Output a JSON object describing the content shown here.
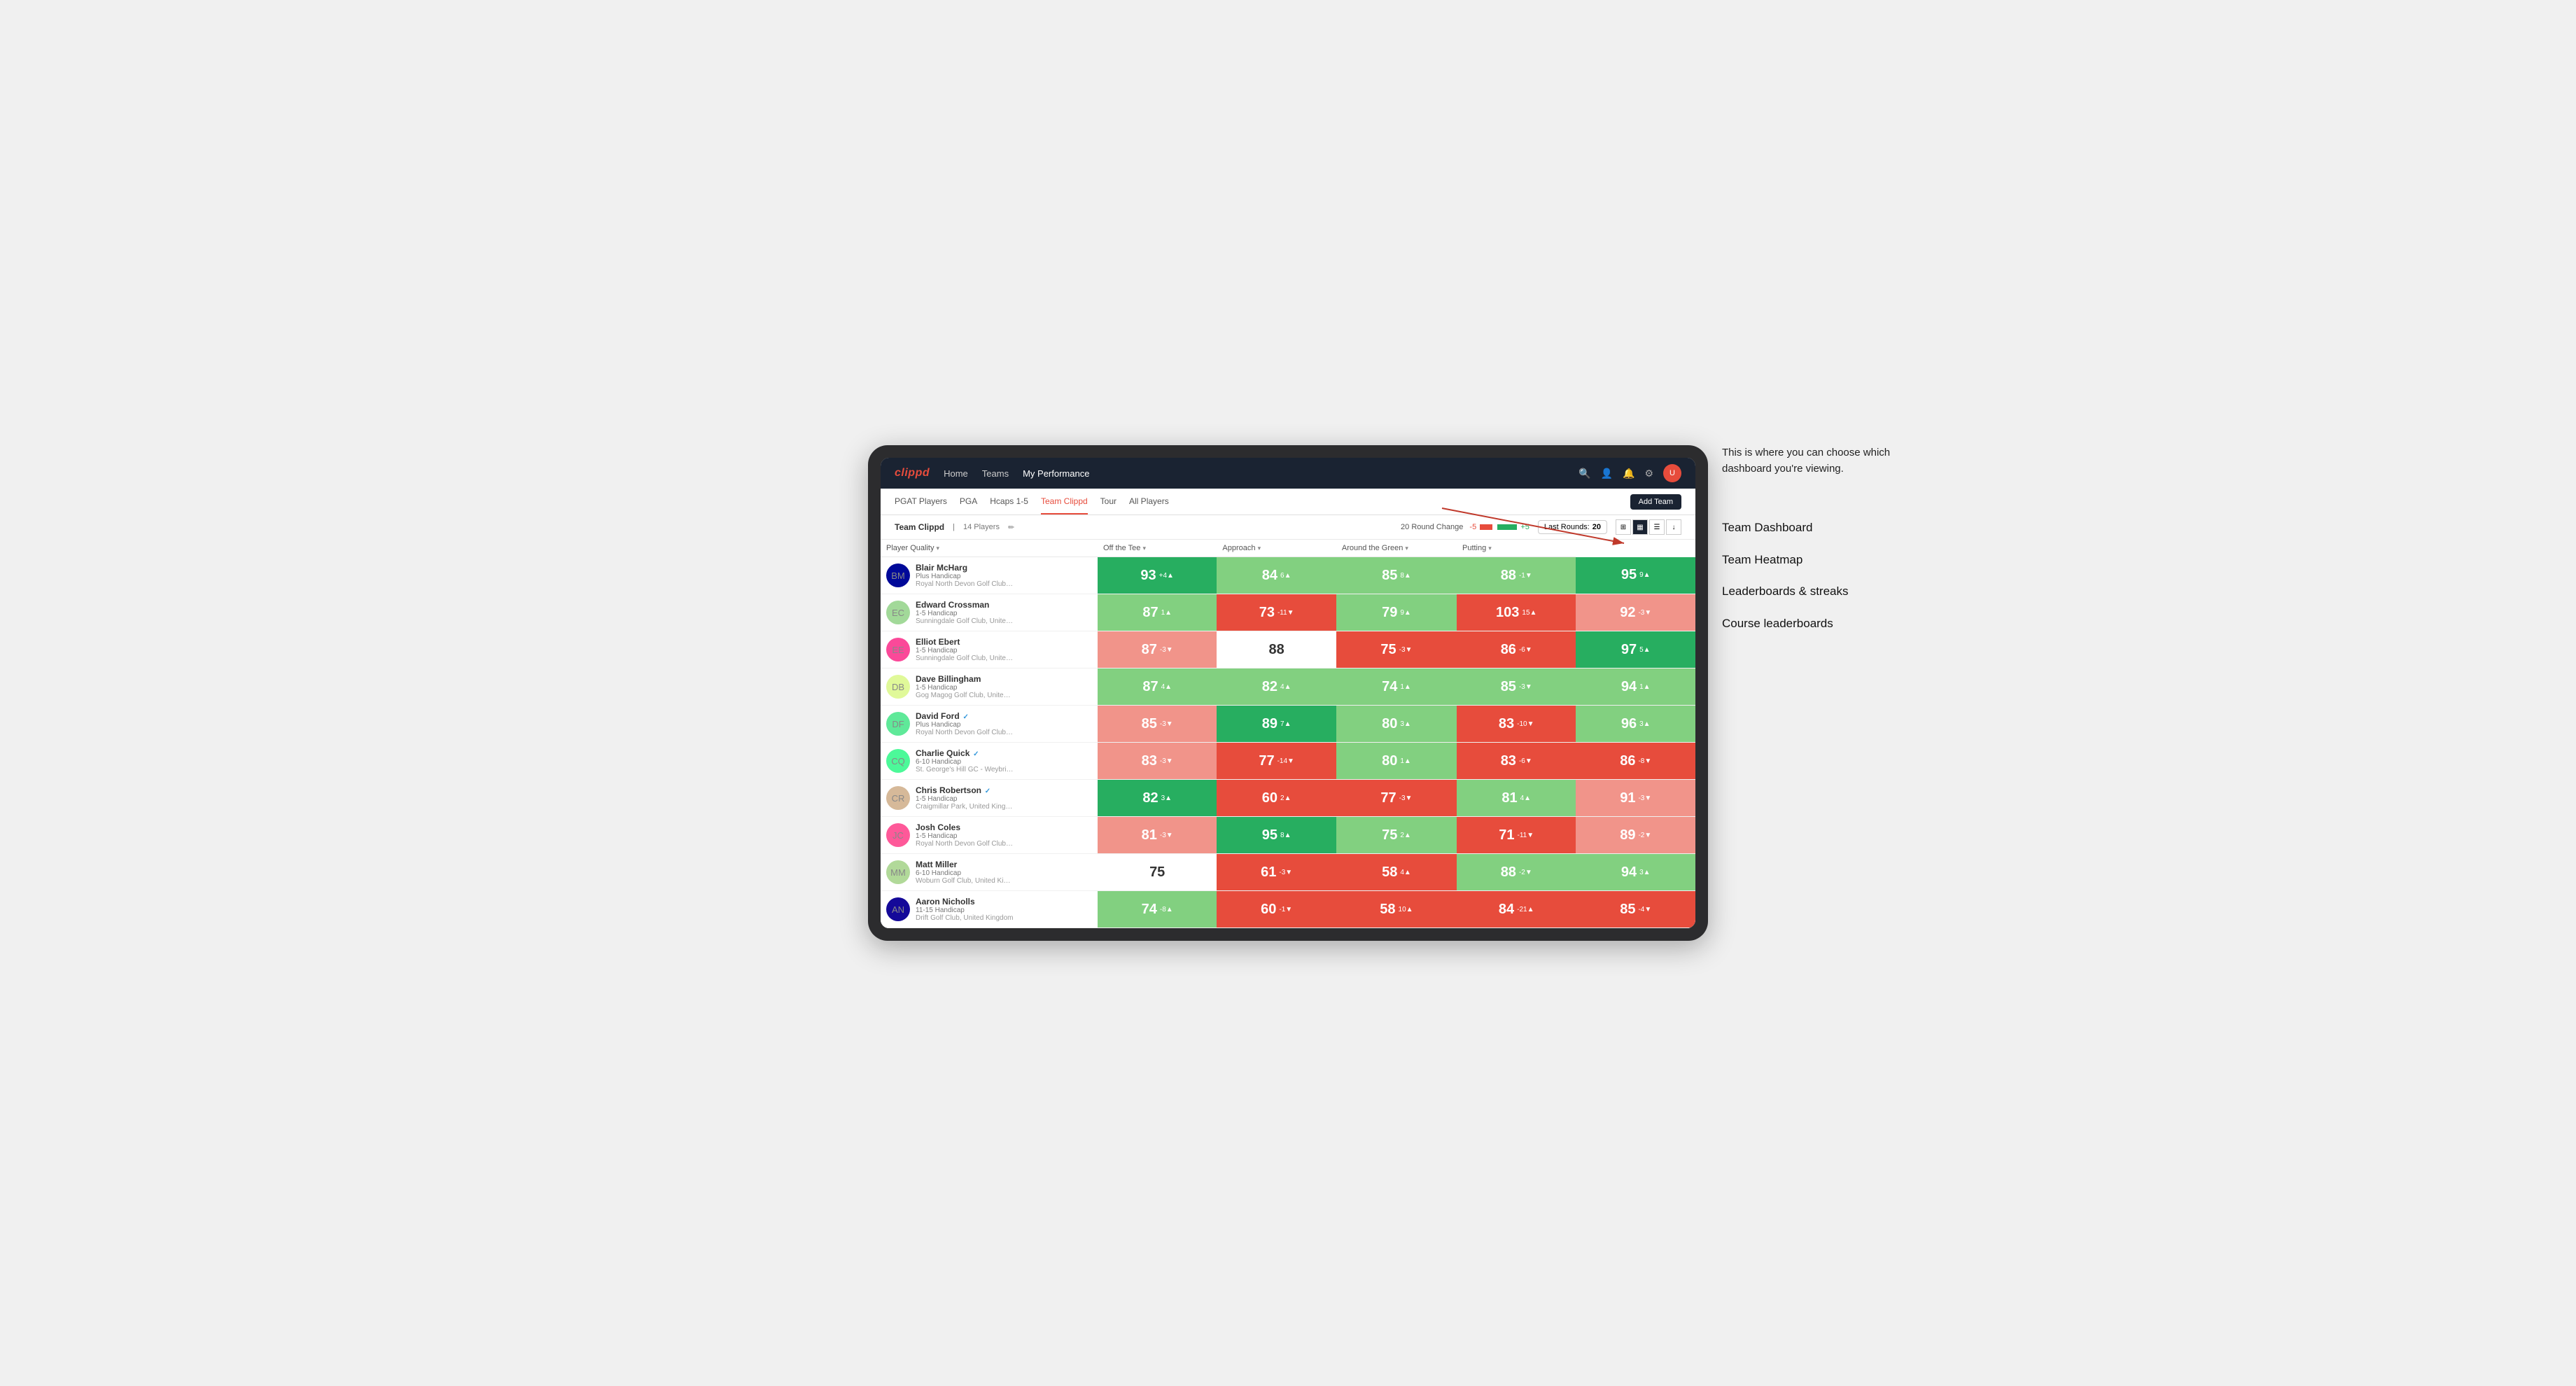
{
  "annotation": {
    "intro": "This is where you can choose which dashboard you're viewing.",
    "items": [
      "Team Dashboard",
      "Team Heatmap",
      "Leaderboards & streaks",
      "Course leaderboards"
    ]
  },
  "nav": {
    "logo": "clippd",
    "links": [
      "Home",
      "Teams",
      "My Performance"
    ],
    "active_link": "My Performance"
  },
  "sub_nav": {
    "links": [
      "PGAT Players",
      "PGA",
      "Hcaps 1-5",
      "Team Clippd",
      "Tour",
      "All Players"
    ],
    "active_link": "Team Clippd",
    "add_team_label": "Add Team"
  },
  "toolbar": {
    "team_name": "Team Clippd",
    "player_count": "14 Players",
    "round_change_label": "20 Round Change",
    "minus_label": "-5",
    "plus_label": "+5",
    "last_rounds_label": "Last Rounds:",
    "last_rounds_value": "20"
  },
  "table": {
    "columns": [
      "Player Quality ▾",
      "Off the Tee ▾",
      "Approach ▾",
      "Around the Green ▾",
      "Putting ▾"
    ],
    "rows": [
      {
        "name": "Blair McHarg",
        "handicap": "Plus Handicap",
        "club": "Royal North Devon Golf Club, United Kingdom",
        "scores": [
          {
            "value": 93,
            "change": "+4▲",
            "bg": "bg-green-dark"
          },
          {
            "value": 84,
            "change": "6▲",
            "bg": "bg-green-light"
          },
          {
            "value": 85,
            "change": "8▲",
            "bg": "bg-green-light"
          },
          {
            "value": 88,
            "change": "-1▼",
            "bg": "bg-green-light"
          },
          {
            "value": 95,
            "change": "9▲",
            "bg": "bg-green-dark"
          }
        ]
      },
      {
        "name": "Edward Crossman",
        "handicap": "1-5 Handicap",
        "club": "Sunningdale Golf Club, United Kingdom",
        "scores": [
          {
            "value": 87,
            "change": "1▲",
            "bg": "bg-green-light"
          },
          {
            "value": 73,
            "change": "-11▼",
            "bg": "bg-red-dark"
          },
          {
            "value": 79,
            "change": "9▲",
            "bg": "bg-green-light"
          },
          {
            "value": 103,
            "change": "15▲",
            "bg": "bg-red-dark"
          },
          {
            "value": 92,
            "change": "-3▼",
            "bg": "bg-red-light"
          }
        ]
      },
      {
        "name": "Elliot Ebert",
        "handicap": "1-5 Handicap",
        "club": "Sunningdale Golf Club, United Kingdom",
        "scores": [
          {
            "value": 87,
            "change": "-3▼",
            "bg": "bg-red-light"
          },
          {
            "value": 88,
            "change": "",
            "bg": "bg-white"
          },
          {
            "value": 75,
            "change": "-3▼",
            "bg": "bg-red-dark"
          },
          {
            "value": 86,
            "change": "-6▼",
            "bg": "bg-red-dark"
          },
          {
            "value": 97,
            "change": "5▲",
            "bg": "bg-green-dark"
          }
        ]
      },
      {
        "name": "Dave Billingham",
        "handicap": "1-5 Handicap",
        "club": "Gog Magog Golf Club, United Kingdom",
        "scores": [
          {
            "value": 87,
            "change": "4▲",
            "bg": "bg-green-light"
          },
          {
            "value": 82,
            "change": "4▲",
            "bg": "bg-green-light"
          },
          {
            "value": 74,
            "change": "1▲",
            "bg": "bg-green-light"
          },
          {
            "value": 85,
            "change": "-3▼",
            "bg": "bg-green-light"
          },
          {
            "value": 94,
            "change": "1▲",
            "bg": "bg-green-light"
          }
        ]
      },
      {
        "name": "David Ford",
        "verified": true,
        "handicap": "Plus Handicap",
        "club": "Royal North Devon Golf Club, United Kingdom",
        "scores": [
          {
            "value": 85,
            "change": "-3▼",
            "bg": "bg-red-light"
          },
          {
            "value": 89,
            "change": "7▲",
            "bg": "bg-green-dark"
          },
          {
            "value": 80,
            "change": "3▲",
            "bg": "bg-green-light"
          },
          {
            "value": 83,
            "change": "-10▼",
            "bg": "bg-red-dark"
          },
          {
            "value": 96,
            "change": "3▲",
            "bg": "bg-green-light"
          }
        ]
      },
      {
        "name": "Charlie Quick",
        "verified": true,
        "handicap": "6-10 Handicap",
        "club": "St. George's Hill GC - Weybridge - Surrey, Uni...",
        "scores": [
          {
            "value": 83,
            "change": "-3▼",
            "bg": "bg-red-light"
          },
          {
            "value": 77,
            "change": "-14▼",
            "bg": "bg-red-dark"
          },
          {
            "value": 80,
            "change": "1▲",
            "bg": "bg-green-light"
          },
          {
            "value": 83,
            "change": "-6▼",
            "bg": "bg-red-dark"
          },
          {
            "value": 86,
            "change": "-8▼",
            "bg": "bg-red-dark"
          }
        ]
      },
      {
        "name": "Chris Robertson",
        "verified": true,
        "handicap": "1-5 Handicap",
        "club": "Craigmillar Park, United Kingdom",
        "scores": [
          {
            "value": 82,
            "change": "3▲",
            "bg": "bg-green-dark"
          },
          {
            "value": 60,
            "change": "2▲",
            "bg": "bg-red-dark"
          },
          {
            "value": 77,
            "change": "-3▼",
            "bg": "bg-red-dark"
          },
          {
            "value": 81,
            "change": "4▲",
            "bg": "bg-green-light"
          },
          {
            "value": 91,
            "change": "-3▼",
            "bg": "bg-red-light"
          }
        ]
      },
      {
        "name": "Josh Coles",
        "handicap": "1-5 Handicap",
        "club": "Royal North Devon Golf Club, United Kingdom",
        "scores": [
          {
            "value": 81,
            "change": "-3▼",
            "bg": "bg-red-light"
          },
          {
            "value": 95,
            "change": "8▲",
            "bg": "bg-green-dark"
          },
          {
            "value": 75,
            "change": "2▲",
            "bg": "bg-green-light"
          },
          {
            "value": 71,
            "change": "-11▼",
            "bg": "bg-red-dark"
          },
          {
            "value": 89,
            "change": "-2▼",
            "bg": "bg-red-light"
          }
        ]
      },
      {
        "name": "Matt Miller",
        "handicap": "6-10 Handicap",
        "club": "Woburn Golf Club, United Kingdom",
        "scores": [
          {
            "value": 75,
            "change": "",
            "bg": "bg-white"
          },
          {
            "value": 61,
            "change": "-3▼",
            "bg": "bg-red-dark"
          },
          {
            "value": 58,
            "change": "4▲",
            "bg": "bg-red-dark"
          },
          {
            "value": 88,
            "change": "-2▼",
            "bg": "bg-green-light"
          },
          {
            "value": 94,
            "change": "3▲",
            "bg": "bg-green-light"
          }
        ]
      },
      {
        "name": "Aaron Nicholls",
        "handicap": "11-15 Handicap",
        "club": "Drift Golf Club, United Kingdom",
        "scores": [
          {
            "value": 74,
            "change": "-8▲",
            "bg": "bg-green-light"
          },
          {
            "value": 60,
            "change": "-1▼",
            "bg": "bg-red-dark"
          },
          {
            "value": 58,
            "change": "10▲",
            "bg": "bg-red-dark"
          },
          {
            "value": 84,
            "change": "-21▲",
            "bg": "bg-red-dark"
          },
          {
            "value": 85,
            "change": "-4▼",
            "bg": "bg-red-dark"
          }
        ]
      }
    ]
  }
}
